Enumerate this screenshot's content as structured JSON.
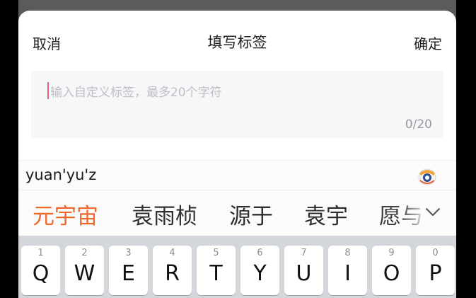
{
  "header": {
    "cancel": "取消",
    "title": "填写标签",
    "confirm": "确定"
  },
  "tag_input": {
    "placeholder": "输入自定义标签，最多20个字符",
    "counter": "0/20"
  },
  "ime": {
    "pinyin": "yuan'yu'z",
    "candidates": [
      "元宇宙",
      "袁雨桢",
      "源于",
      "袁宇",
      "愿与"
    ],
    "logo_icon": "ime-mascot-icon",
    "expand_icon": "chevron-down-icon",
    "accent_color": "#ee6a2c"
  },
  "keyboard": {
    "keys": [
      {
        "num": "1",
        "letter": "Q"
      },
      {
        "num": "2",
        "letter": "W"
      },
      {
        "num": "3",
        "letter": "E"
      },
      {
        "num": "4",
        "letter": "R"
      },
      {
        "num": "5",
        "letter": "T"
      },
      {
        "num": "6",
        "letter": "Y"
      },
      {
        "num": "7",
        "letter": "U"
      },
      {
        "num": "8",
        "letter": "I"
      },
      {
        "num": "9",
        "letter": "O"
      },
      {
        "num": "0",
        "letter": "P"
      }
    ]
  }
}
